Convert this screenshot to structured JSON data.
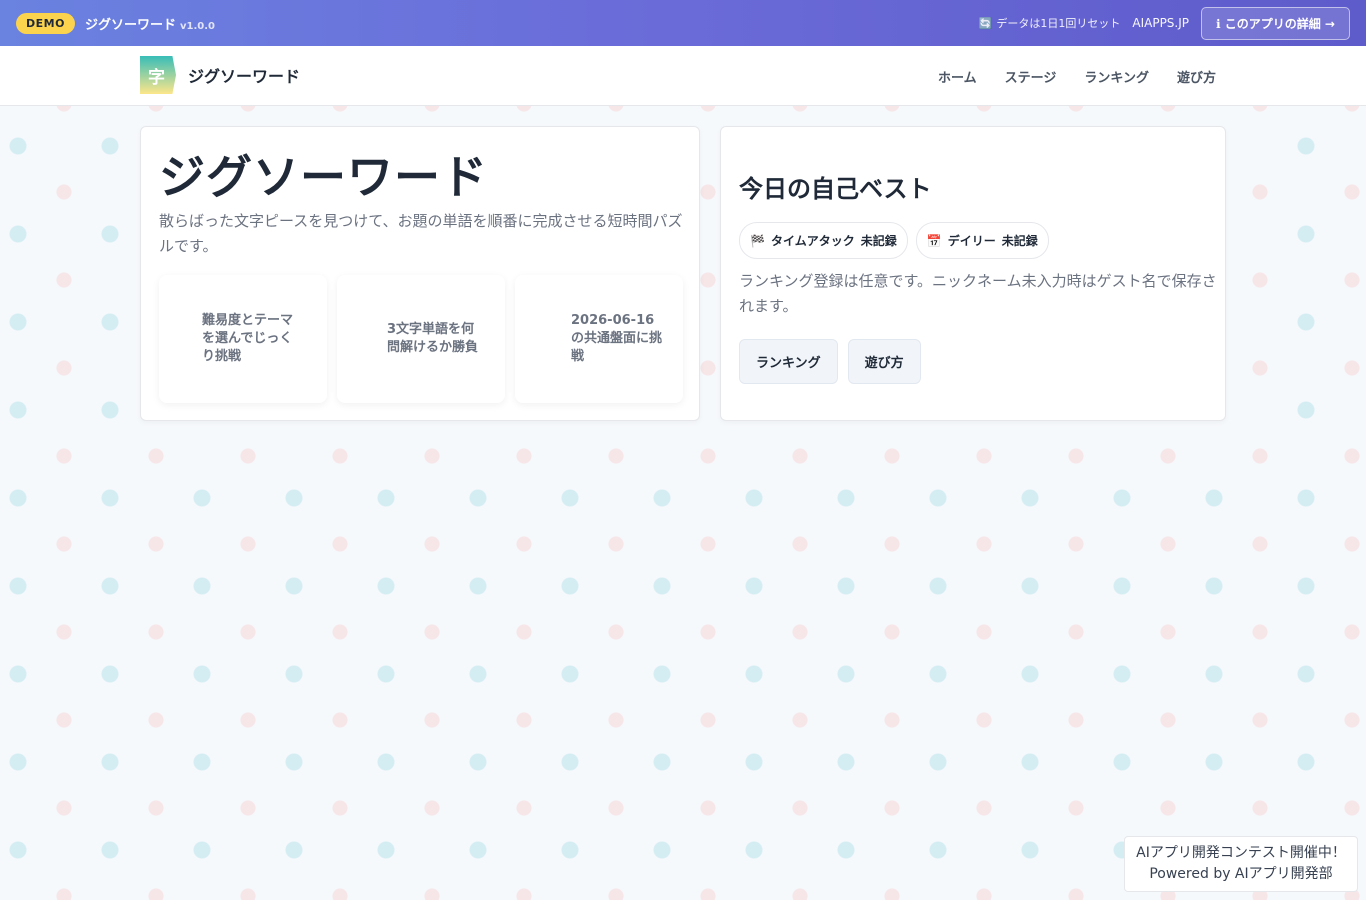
{
  "demo_bar": {
    "badge": "DEMO",
    "title": "ジグソーワード",
    "version": "v1.0.0",
    "reset_icon": "🔄",
    "reset_text": "データは1日1回リセット",
    "domain": "AIAPPS.JP",
    "detail_button": "ℹ このアプリの詳細 →"
  },
  "nav": {
    "logo_char": "字",
    "brand": "ジグソーワード",
    "links": [
      "ホーム",
      "ステージ",
      "ランキング",
      "遊び方"
    ]
  },
  "hero": {
    "title": "ジグソーワード",
    "description": "散らばった文字ピースを見つけて、お題の単語を順番に完成させる短時間パズルです。",
    "features": [
      "難易度とテーマを選んでじっくり挑戦",
      "3文字単語を何問解けるか勝負",
      "2026-06-16 の共通盤面に挑戦"
    ]
  },
  "best": {
    "title": "今日の自己ベスト",
    "chips": [
      {
        "icon": "🏁",
        "label": "タイムアタック",
        "value": "未記録"
      },
      {
        "icon": "📅",
        "label": "デイリー",
        "value": "未記録"
      }
    ],
    "note": "ランキング登録は任意です。ニックネーム未入力時はゲスト名で保存されます。",
    "buttons": [
      "ランキング",
      "遊び方"
    ]
  },
  "promo": {
    "line1": "AIアプリ開発コンテスト開催中！",
    "line2": "Powered by AIアプリ開発部"
  }
}
